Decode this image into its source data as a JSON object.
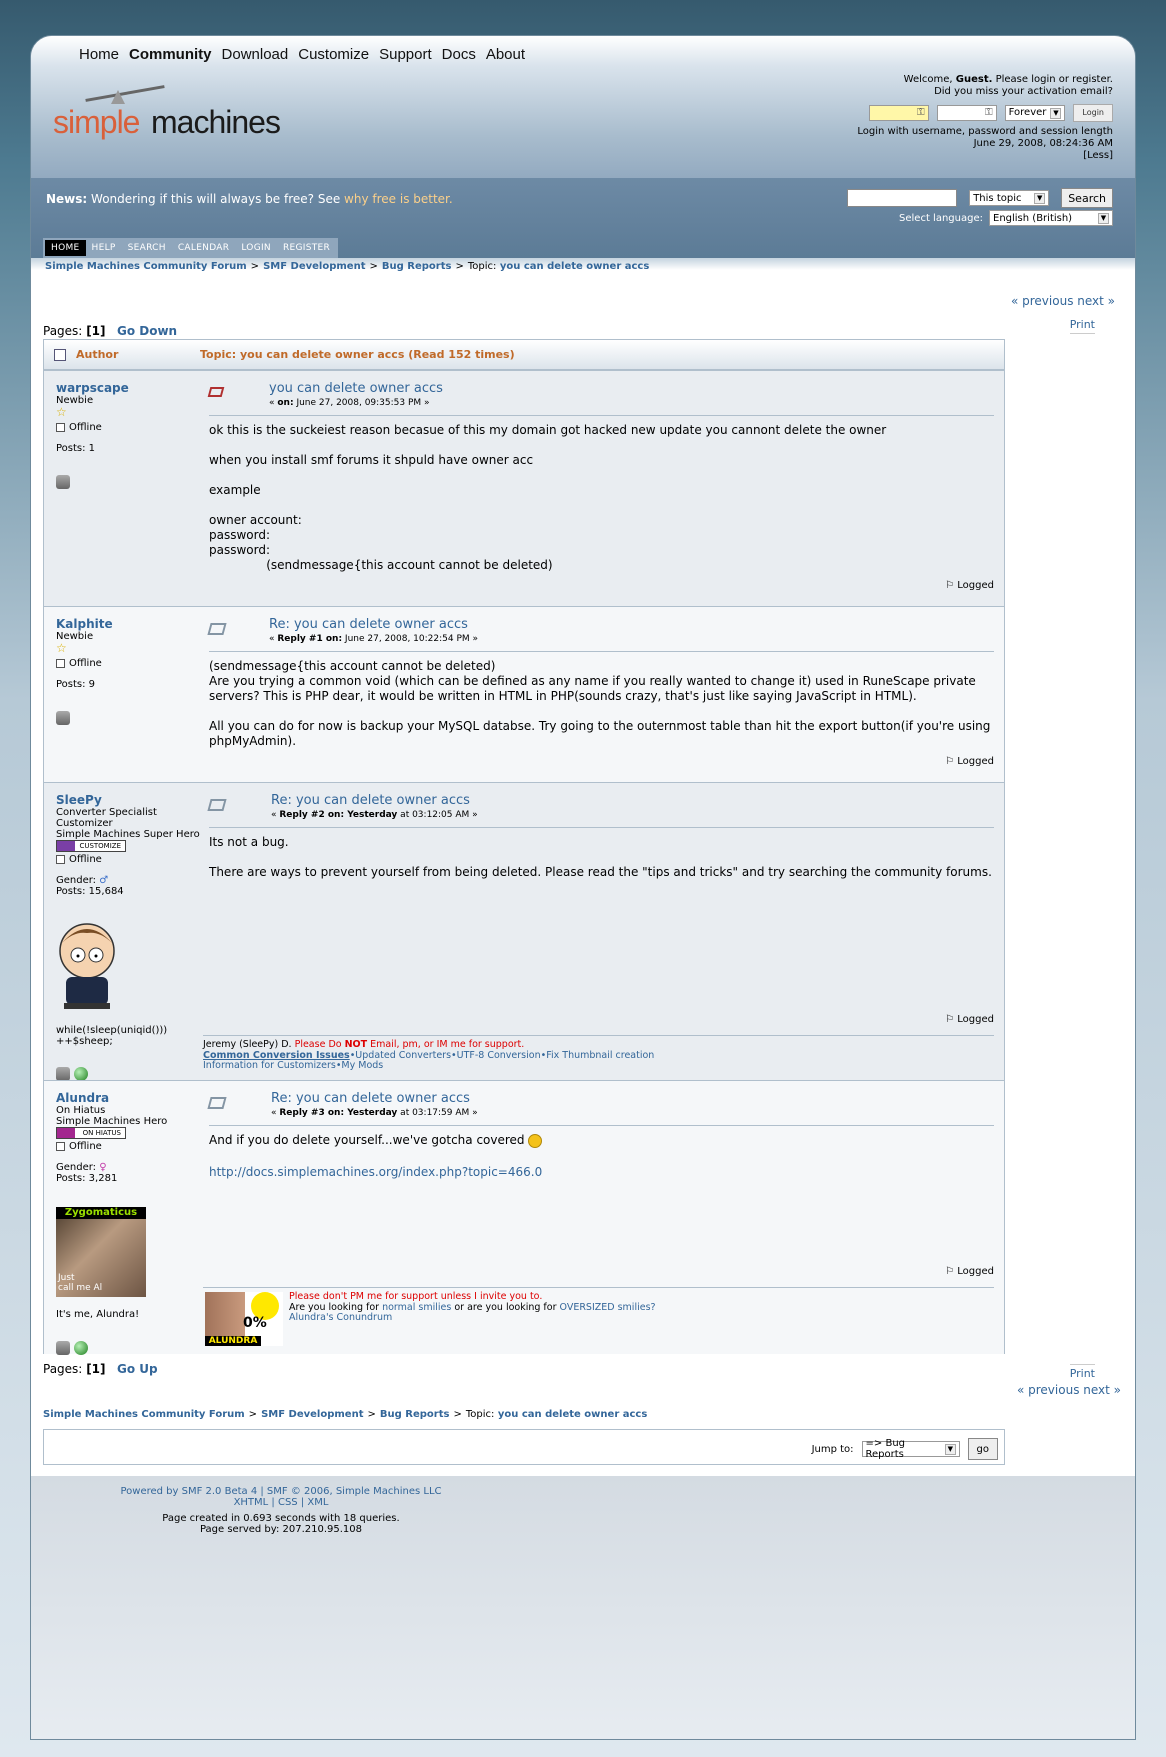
{
  "nav": {
    "items": [
      "Home",
      "Community",
      "Download",
      "Customize",
      "Support",
      "Docs",
      "About"
    ],
    "active": "Community"
  },
  "logo": {
    "part1": "simple",
    "part2": "machines"
  },
  "userbox": {
    "welcome_pre": "Welcome, ",
    "guest": "Guest.",
    "welcome_post": " Please login or register.",
    "activation": "Did you miss your activation email?",
    "length_value": "Forever",
    "login_button": "Login",
    "hint": "Login with username, password and session length",
    "datetime": "June 29, 2008, 08:24:36 AM",
    "less": "[Less]"
  },
  "news": {
    "label": "News:",
    "text": " Wondering if this will always be free?  See ",
    "link": "why free is better."
  },
  "search": {
    "scope": "This topic",
    "button": "Search",
    "lang_label": "Select language:",
    "lang_value": "English (British)"
  },
  "menu": [
    "HOME",
    "HELP",
    "SEARCH",
    "CALENDAR",
    "LOGIN",
    "REGISTER"
  ],
  "breadcrumb": {
    "c1": "Simple Machines Community Forum",
    "c2": "SMF Development",
    "c3": "Bug Reports",
    "topic_label": "Topic:",
    "c4": "you can delete owner accs",
    "sep": ">"
  },
  "pager": {
    "label": "Pages:",
    "current": "[1]",
    "go_down": "Go Down",
    "go_up": "Go Up",
    "prevnext": "« previous next »",
    "print": "Print"
  },
  "topic_header": {
    "author": "Author",
    "topic": "Topic: you can delete owner accs  (Read 152 times)"
  },
  "posts": [
    {
      "name": "warpscape",
      "rank": "Newbie",
      "extra": [
        "",
        ""
      ],
      "status": "Offline",
      "gender": "",
      "posts": "Posts: 1",
      "title": "you can delete owner accs",
      "date_prefix": "« ",
      "date_label": "on:",
      "date": " June 27, 2008, 09:35:53 PM »",
      "body": "ok this is the suckeiest reason becasue of this my domain got hacked new update you cannont delete the owner\n\nwhen you install smf forums it shpuld have owner acc\n\nexample\n\nowner account:\npassword:\npassword:\n               (sendmessage{this account cannot be deleted)",
      "logged": "Logged"
    },
    {
      "name": "Kalphite",
      "rank": "Newbie",
      "extra": [
        "",
        ""
      ],
      "status": "Offline",
      "gender": "",
      "posts": "Posts: 9",
      "title": "Re: you can delete owner accs",
      "date_prefix": "« ",
      "date_label": "Reply #1 on:",
      "date": " June 27, 2008, 10:22:54 PM »",
      "body": "(sendmessage{this account cannot be deleted)\nAre you trying a common void (which can be defined as any name if you really wanted to change it) used in RuneScape private servers? This is PHP dear, it would be written in HTML in PHP(sounds crazy, that's just like saying JavaScript in HTML).\n\nAll you can do for now is backup your MySQL databse. Try going to the outernmost table than hit the export button(if you're using phpMyAdmin).",
      "logged": "Logged"
    },
    {
      "name": "SleePy",
      "rank": "Converter Specialist",
      "extra": [
        "Customizer",
        "Simple Machines Super Hero"
      ],
      "badge": "CUSTOMIZE",
      "status": "Offline",
      "gender": "Gender:",
      "posts": "Posts: 15,684",
      "under": "while(!sleep(uniqid()))\n++$sheep;",
      "title": "Re: you can delete owner accs",
      "date_prefix": "« ",
      "date_label": "Reply #2 on: Yesterday",
      "date": " at 03:12:05 AM »",
      "body": "Its not a bug.\n\nThere are ways to prevent yourself from being deleted. Please read the \"tips and tricks\" and try searching the community forums.",
      "logged": "Logged",
      "sig1": "Jeremy (SleePy) D. ",
      "sig1_red_a": "Please Do ",
      "sig1_red_b": "NOT",
      "sig1_red_c": " Email, pm, or IM me for support.",
      "sig2": "Common Conversion Issues",
      "sig3": "•Updated Converters•UTF-8 Conversion•Fix Thumbnail creation",
      "sig4": "Information for Customizers•My Mods"
    },
    {
      "name": "Alundra",
      "rank": "On Hiatus",
      "extra": [
        "Simple Machines Hero",
        ""
      ],
      "badge": "ON HIATUS",
      "status": "Offline",
      "gender": "Gender:",
      "posts": "Posts: 3,281",
      "avatar_text": "Zygomaticus",
      "avatar_sub": "Just\ncall me Al",
      "under": "It's me, Alundra!",
      "title": "Re: you can delete owner accs",
      "date_prefix": "« ",
      "date_label": "Reply #3 on: Yesterday",
      "date": " at 03:17:59 AM »",
      "body": "And if you do delete yourself...we've gotcha covered",
      "link": "http://docs.simplemachines.org/index.php?topic=466.0",
      "logged": "Logged",
      "sig_red": "Please don't PM me for support unless I invite you to.",
      "sig_a": "Are you looking for ",
      "sig_b": "normal smilies",
      "sig_c": " or are you looking for ",
      "sig_d": "OVERSIZED smilies?",
      "sig_e": "Alundra's Conundrum",
      "sig_img_label": "ALUNDRA",
      "sig_img_pct": "0%"
    }
  ],
  "jump": {
    "label": "Jump to:",
    "value": "=> Bug Reports",
    "button": "go"
  },
  "footer": {
    "l1": "Powered by SMF 2.0 Beta 4 | SMF © 2006, Simple Machines LLC",
    "l2": "XHTML | CSS | XML",
    "t1": "Page created in 0.693 seconds with 18 queries.",
    "t2": "Page served by: 207.210.95.108"
  },
  "colors": {
    "accent": "#336699",
    "author_header": "#c06a29",
    "sig_red": "#dd0000"
  }
}
